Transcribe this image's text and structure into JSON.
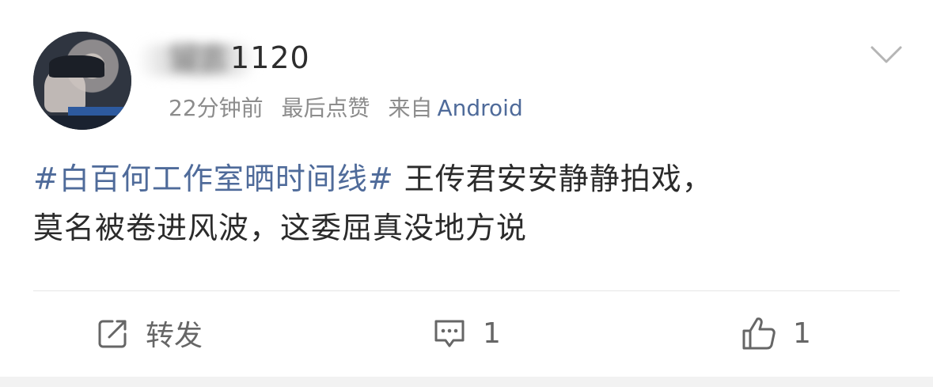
{
  "post": {
    "user": {
      "name_hidden": "留言",
      "name_visible": "1120"
    },
    "timestamp": "22分钟前",
    "activity": "最后点赞",
    "source_label": "来自",
    "source_device": "Android",
    "text": {
      "topic": "#白百何工作室晒时间线#",
      "line1_rest": " 王传君安安静静拍戏，",
      "line2": "莫名被卷进风波，这委屈真没地方说"
    }
  },
  "actions": {
    "repost_label": "转发",
    "comment_count": "1",
    "like_count": "1"
  },
  "icons": {
    "menu": "chevron-down-icon",
    "repost": "share-icon",
    "comment": "comment-icon",
    "like": "thumb-up-icon"
  },
  "colors": {
    "topic_link": "#4f6b9a",
    "meta_text": "#8c8c8c",
    "body_text": "#2b2b2b"
  }
}
